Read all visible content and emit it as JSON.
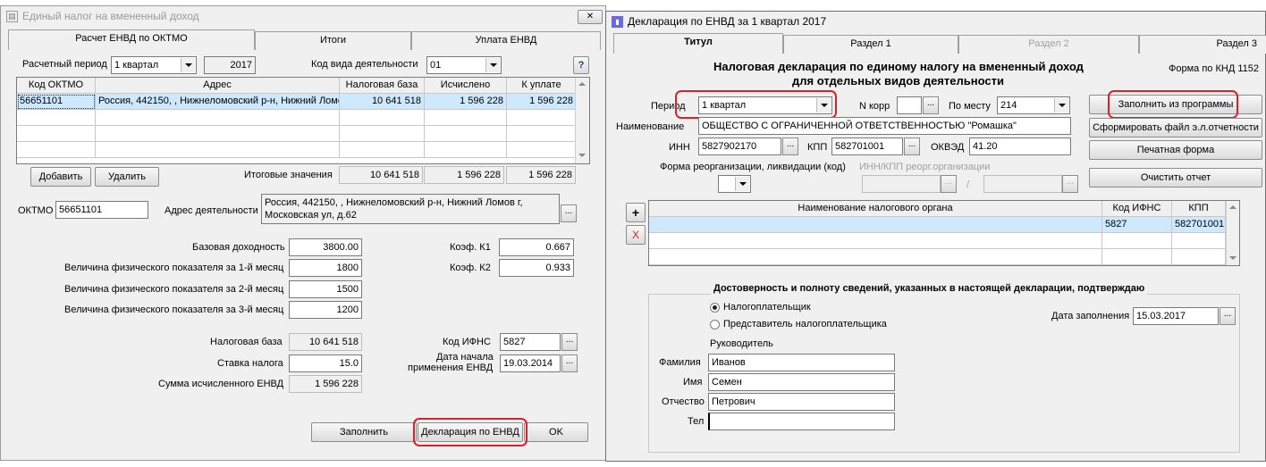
{
  "left": {
    "title": "Единый налог на вмененный доход",
    "tabs": [
      "Расчет ЕНВД по ОКТМО",
      "Итоги",
      "Уплата ЕНВД"
    ],
    "period_label": "Расчетный период",
    "period_value": "1 квартал",
    "year": "2017",
    "activity_code_label": "Код вида деятельности",
    "activity_code_value": "01",
    "help": "?",
    "table": {
      "columns": [
        "Код ОКТМО",
        "Адрес",
        "Налоговая база",
        "Исчислено",
        "К уплате"
      ],
      "rows": [
        [
          "56651101",
          "Россия, 442150, , Нижнеломовский р-н, Нижний Ломов г,",
          "10 641 518",
          "1 596 228",
          "1 596 228"
        ]
      ]
    },
    "add_button": "Добавить",
    "delete_button": "Удалить",
    "totals_label": "Итоговые значения",
    "totals": [
      "10 641 518",
      "1 596 228",
      "1 596 228"
    ],
    "oktmo_label": "ОКТМО",
    "oktmo_value": "56651101",
    "address_label": "Адрес деятельности",
    "address_value": "Россия, 442150, , Нижнеломовский р-н, Нижний Ломов г, Московская ул, д.62",
    "base_income_label": "Базовая доходность",
    "base_income_value": "3800.00",
    "phys1_label": "Величина физического показателя за 1-й месяц",
    "phys1_value": "1800",
    "phys2_label": "Величина физического показателя за 2-й месяц",
    "phys2_value": "1500",
    "phys3_label": "Величина физического показателя за 3-й месяц",
    "phys3_value": "1200",
    "k1_label": "Коэф. К1",
    "k1_value": "0.667",
    "k2_label": "Коэф. К2",
    "k2_value": "0.933",
    "tax_base_label": "Налоговая база",
    "tax_base_value": "10 641 518",
    "tax_rate_label": "Ставка налога",
    "tax_rate_value": "15.0",
    "tax_sum_label": "Сумма исчисленного ЕНВД",
    "tax_sum_value": "1 596 228",
    "ifns_label": "Код ИФНС",
    "ifns_value": "5827",
    "start_date_label_1": "Дата начала",
    "start_date_label_2": "применения ЕНВД",
    "start_date_value": "19.03.2014",
    "fill_button": "Заполнить",
    "declaration_button": "Декларация по ЕНВД",
    "ok_button": "OK",
    "close": "✕"
  },
  "right": {
    "title": "Декларация по ЕНВД за 1 квартал 2017",
    "tabs": [
      "Титул",
      "Раздел 1",
      "Раздел 2",
      "Раздел 3"
    ],
    "heading_1": "Налоговая декларация по единому налогу на вмененный доход",
    "heading_2": "для отдельных видов деятельности",
    "form_code": "Форма по КНД 1152",
    "period_label": "Период",
    "period_value": "1 квартал",
    "ncorr_label": "N корр",
    "ncorr_value": "",
    "place_label": "По месту",
    "place_value": "214",
    "name_label": "Наименование",
    "name_value": "ОБЩЕСТВО С ОГРАНИЧЕННОЙ ОТВЕТСТВЕННОСТЬЮ \"Ромашка\"",
    "inn_label": "ИНН",
    "inn_value": "5827902170",
    "kpp_label": "КПП",
    "kpp_value": "582701001",
    "okved_label": "ОКВЭД",
    "okved_value": "41.20",
    "reorg_label": "Форма реорганизации, ликвидации (код)",
    "reorg_inn_label": "ИНН/КПП реорг.организации",
    "slash": "/",
    "fill_from_program": "Заполнить из программы",
    "generate_file": "Сформировать файл э.л.отчетности",
    "print_form": "Печатная форма",
    "clear_report": "Очистить отчет",
    "plus": "+",
    "x": "X",
    "table": {
      "columns": [
        "Наименование налогового органа",
        "Код ИФНС",
        "КПП"
      ],
      "rows": [
        [
          "",
          "5827",
          "582701001"
        ]
      ]
    },
    "confirm_title": "Достоверность и полноту сведений, указанных в настоящей декларации, подтверждаю",
    "taxpayer": "Налогоплательщик",
    "representative": "Представитель налогоплательщика",
    "fill_date_label": "Дата заполнения",
    "fill_date_value": "15.03.2017",
    "head_label": "Руководитель",
    "surname_label": "Фамилия",
    "surname_value": "Иванов",
    "firstname_label": "Имя",
    "firstname_value": "Семен",
    "patronymic_label": "Отчество",
    "patronymic_value": "Петрович",
    "phone_label": "Тел",
    "phone_value": ""
  },
  "dots": "...",
  "colors": {
    "highlight": "#d9202b",
    "selected_row": "#cde8ff"
  }
}
